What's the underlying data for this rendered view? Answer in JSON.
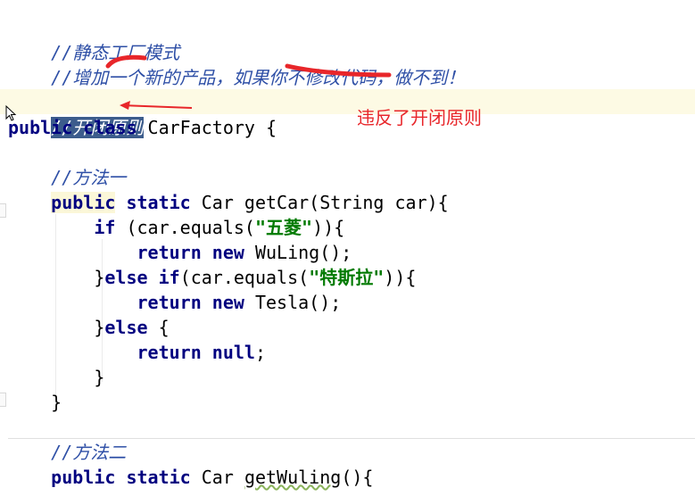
{
  "code": {
    "line1_comment": "//静态工厂模式",
    "line2_comment": "//增加一个新的产品，如果你不修改代码，做不到！",
    "line4_comment": "//开闭原则",
    "line5_kw1": "public",
    "line5_kw2": "class",
    "line5_rest": " CarFactory {",
    "line7_comment": "//方法一",
    "line8_kw1": "public",
    "line8_kw2": "static",
    "line8_rest": " Car getCar(String car){",
    "line9_kw": "if",
    "line9_pre": " (car.equals(",
    "line9_str": "\"五菱\"",
    "line9_post": ")){",
    "line10_kw1": "return",
    "line10_kw2": "new",
    "line10_rest": " WuLing();",
    "line11_brace": "}",
    "line11_kw1": "else",
    "line11_kw2": "if",
    "line11_pre": "(car.equals(",
    "line11_str": "\"特斯拉\"",
    "line11_post": ")){",
    "line12_kw1": "return",
    "line12_kw2": "new",
    "line12_rest": " Tesla();",
    "line13_brace": "}",
    "line13_kw": "else",
    "line13_rest": " {",
    "line14_kw1": "return",
    "line14_kw2": "null",
    "line14_rest": ";",
    "line15_brace": "}",
    "line16_brace": "}",
    "line18_comment": "//方法二",
    "line19_kw1": "public",
    "line19_kw2": "static",
    "line19_mid": " Car ",
    "line19_method": "getWuling",
    "line19_rest": "(){"
  },
  "annotation_text": "违反了开闭原则",
  "colors": {
    "comment": "#2e4fa6",
    "keyword": "#000080",
    "string": "#007a00",
    "annotation_red": "#e8262a",
    "selection": "#3c5c8c",
    "current_line": "#fdfae4"
  },
  "icons": {
    "cursor": "text-cursor-arrow-icon"
  }
}
